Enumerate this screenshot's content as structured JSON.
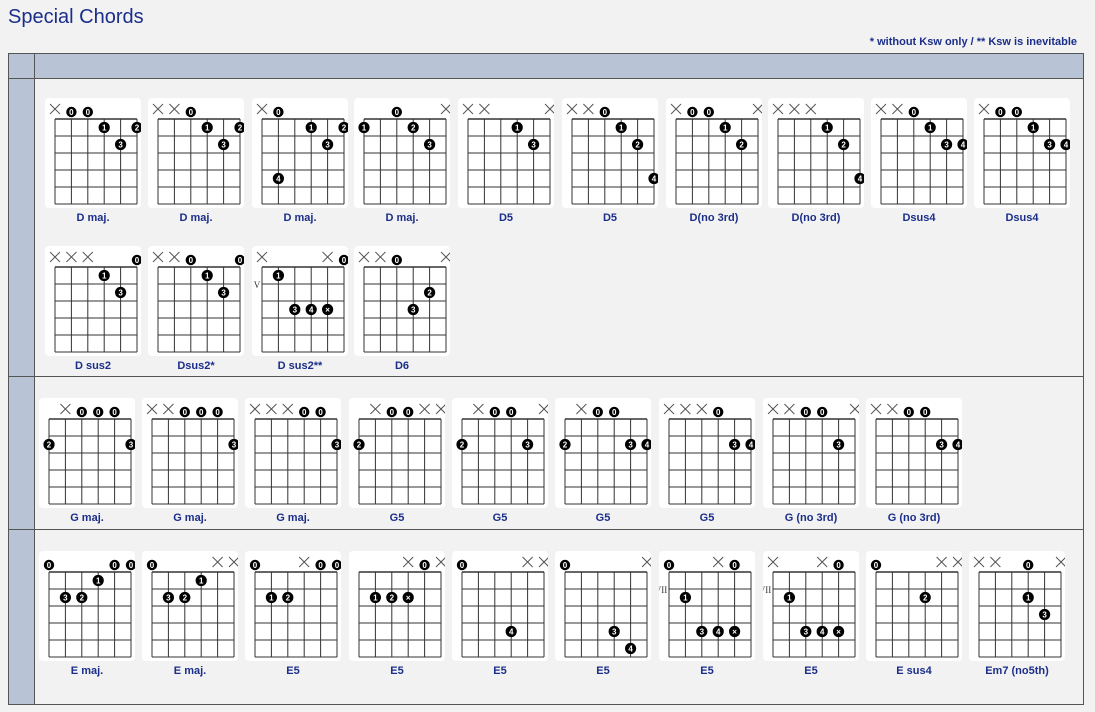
{
  "title": "Special Chords",
  "legend": "* without Ksw only  / ** Ksw is inevitable",
  "marks": {
    "open": "0",
    "mute": "×",
    "fingers": [
      "1",
      "2",
      "3",
      "4"
    ]
  },
  "groups": [
    {
      "chords": [
        {
          "name": "D maj.",
          "top": [
            "x",
            "o",
            "o",
            "",
            "",
            ""
          ],
          "dots": [
            [
              1,
              3,
              "1"
            ],
            [
              1,
              5,
              "2"
            ],
            [
              2,
              4,
              "3"
            ]
          ]
        },
        {
          "name": "D maj.",
          "top": [
            "x",
            "x",
            "o",
            "",
            "",
            ""
          ],
          "dots": [
            [
              1,
              3,
              "1"
            ],
            [
              1,
              5,
              "2"
            ],
            [
              2,
              4,
              "3"
            ]
          ]
        },
        {
          "name": "D maj.",
          "top": [
            "x",
            "o",
            "",
            "",
            "",
            ""
          ],
          "dots": [
            [
              1,
              3,
              "1"
            ],
            [
              1,
              5,
              "2"
            ],
            [
              2,
              4,
              "3"
            ],
            [
              4,
              1,
              "4"
            ]
          ]
        },
        {
          "name": "D maj.",
          "top": [
            "",
            "",
            "o",
            "",
            "",
            "x"
          ],
          "dots": [
            [
              1,
              0,
              "1"
            ],
            [
              1,
              3,
              "2"
            ],
            [
              2,
              4,
              "3"
            ]
          ]
        },
        {
          "name": "D5",
          "top": [
            "x",
            "x",
            "",
            "",
            "",
            "x"
          ],
          "dots": [
            [
              1,
              3,
              "1"
            ],
            [
              2,
              4,
              "3"
            ]
          ]
        },
        {
          "name": "D5",
          "top": [
            "x",
            "x",
            "o",
            "",
            "",
            ""
          ],
          "dots": [
            [
              1,
              3,
              "1"
            ],
            [
              2,
              4,
              "2"
            ],
            [
              4,
              5,
              "4"
            ]
          ]
        },
        {
          "name": "D(no 3rd)",
          "top": [
            "x",
            "o",
            "o",
            "",
            "",
            "x"
          ],
          "dots": [
            [
              1,
              3,
              "1"
            ],
            [
              2,
              4,
              "2"
            ]
          ]
        },
        {
          "name": "D(no 3rd)",
          "top": [
            "x",
            "x",
            "x",
            "",
            "",
            ""
          ],
          "dots": [
            [
              1,
              3,
              "1"
            ],
            [
              2,
              4,
              "2"
            ],
            [
              4,
              5,
              "4"
            ]
          ]
        },
        {
          "name": "Dsus4",
          "top": [
            "x",
            "x",
            "o",
            "",
            "",
            ""
          ],
          "dots": [
            [
              1,
              3,
              "1"
            ],
            [
              2,
              4,
              "3"
            ],
            [
              2,
              5,
              "4"
            ]
          ]
        },
        {
          "name": "Dsus4",
          "top": [
            "x",
            "o",
            "o",
            "",
            "",
            ""
          ],
          "dots": [
            [
              1,
              3,
              "1"
            ],
            [
              2,
              4,
              "3"
            ],
            [
              2,
              5,
              "4"
            ]
          ]
        },
        {
          "name": "D sus2",
          "top": [
            "x",
            "x",
            "x",
            "",
            "",
            "o"
          ],
          "dots": [
            [
              1,
              3,
              "1"
            ],
            [
              2,
              4,
              "3"
            ]
          ]
        },
        {
          "name": "Dsus2*",
          "top": [
            "x",
            "x",
            "o",
            "",
            "",
            "o"
          ],
          "dots": [
            [
              1,
              3,
              "1"
            ],
            [
              2,
              4,
              "3"
            ]
          ]
        },
        {
          "name": "D sus2**",
          "top": [
            "x",
            "",
            "",
            "",
            "x",
            "o"
          ],
          "fret": "V",
          "dots": [
            [
              1,
              1,
              "1"
            ],
            [
              3,
              2,
              "3"
            ],
            [
              3,
              3,
              "4"
            ],
            [
              3,
              4,
              "x"
            ]
          ]
        },
        {
          "name": "D6",
          "top": [
            "x",
            "x",
            "o",
            "",
            "",
            "x"
          ],
          "dots": [
            [
              2,
              4,
              "2"
            ],
            [
              3,
              3,
              "3"
            ]
          ]
        }
      ]
    },
    {
      "chords": [
        {
          "name": "G maj.",
          "top": [
            "",
            "x",
            "o",
            "o",
            "o",
            ""
          ],
          "dots": [
            [
              2,
              0,
              "2"
            ],
            [
              2,
              5,
              "3"
            ]
          ]
        },
        {
          "name": "G maj.",
          "top": [
            "x",
            "x",
            "o",
            "o",
            "o",
            ""
          ],
          "dots": [
            [
              2,
              5,
              "3"
            ]
          ]
        },
        {
          "name": "G maj.",
          "top": [
            "x",
            "x",
            "x",
            "o",
            "o",
            ""
          ],
          "dots": [
            [
              2,
              5,
              "3"
            ]
          ]
        },
        {
          "name": "G5",
          "top": [
            "",
            "x",
            "o",
            "o",
            "x",
            "x"
          ],
          "dots": [
            [
              2,
              0,
              "2"
            ]
          ]
        },
        {
          "name": "G5",
          "top": [
            "",
            "x",
            "o",
            "o",
            "",
            "x"
          ],
          "dots": [
            [
              2,
              0,
              "2"
            ],
            [
              2,
              4,
              "3"
            ]
          ]
        },
        {
          "name": "G5",
          "top": [
            "",
            "x",
            "o",
            "o",
            "",
            ""
          ],
          "dots": [
            [
              2,
              0,
              "2"
            ],
            [
              2,
              4,
              "3"
            ],
            [
              2,
              5,
              "4"
            ]
          ]
        },
        {
          "name": "G5",
          "top": [
            "x",
            "x",
            "x",
            "o",
            "",
            ""
          ],
          "dots": [
            [
              2,
              4,
              "3"
            ],
            [
              2,
              5,
              "4"
            ]
          ]
        },
        {
          "name": "G (no 3rd)",
          "top": [
            "x",
            "x",
            "o",
            "o",
            "",
            "x"
          ],
          "dots": [
            [
              2,
              4,
              "3"
            ]
          ]
        },
        {
          "name": "G (no 3rd)",
          "top": [
            "x",
            "x",
            "o",
            "o",
            "",
            ""
          ],
          "dots": [
            [
              2,
              4,
              "3"
            ],
            [
              2,
              5,
              "4"
            ]
          ]
        }
      ]
    },
    {
      "chords": [
        {
          "name": "E maj.",
          "top": [
            "o",
            "",
            "",
            "",
            "o",
            "o"
          ],
          "dots": [
            [
              1,
              3,
              "1"
            ],
            [
              2,
              1,
              "3"
            ],
            [
              2,
              2,
              "2"
            ]
          ]
        },
        {
          "name": "E maj.",
          "top": [
            "o",
            "",
            "",
            "",
            "x",
            "x"
          ],
          "dots": [
            [
              1,
              3,
              "1"
            ],
            [
              2,
              1,
              "3"
            ],
            [
              2,
              2,
              "2"
            ]
          ]
        },
        {
          "name": "E5",
          "top": [
            "o",
            "",
            "",
            "x",
            "o",
            "o"
          ],
          "dots": [
            [
              2,
              1,
              "1"
            ],
            [
              2,
              2,
              "2"
            ]
          ]
        },
        {
          "name": "E5",
          "top": [
            "",
            "",
            "",
            "x",
            "o",
            "x"
          ],
          "dots": [
            [
              2,
              1,
              "1"
            ],
            [
              2,
              2,
              "2"
            ],
            [
              2,
              3,
              "x"
            ]
          ]
        },
        {
          "name": "E5",
          "top": [
            "o",
            "",
            "",
            "",
            "x",
            "x"
          ],
          "bar": [
            2,
            1,
            2,
            "1 1"
          ],
          "dots": [
            [
              4,
              3,
              "4"
            ]
          ]
        },
        {
          "name": "E5",
          "top": [
            "o",
            "",
            "",
            "",
            "",
            "x"
          ],
          "bar": [
            2,
            1,
            2,
            "1 1"
          ],
          "dots": [
            [
              4,
              3,
              "3"
            ],
            [
              5,
              4,
              "4"
            ]
          ]
        },
        {
          "name": "E5",
          "top": [
            "o",
            "",
            "",
            "x",
            "o",
            ""
          ],
          "fret": "VII",
          "dots": [
            [
              2,
              1,
              "1"
            ],
            [
              4,
              2,
              "3"
            ],
            [
              4,
              3,
              "4"
            ],
            [
              4,
              4,
              "x"
            ]
          ]
        },
        {
          "name": "E5",
          "top": [
            "x",
            "",
            "",
            "x",
            "o",
            ""
          ],
          "fret": "VII",
          "dots": [
            [
              2,
              1,
              "1"
            ],
            [
              4,
              2,
              "3"
            ],
            [
              4,
              3,
              "4"
            ],
            [
              4,
              4,
              "x"
            ]
          ]
        },
        {
          "name": "E sus4",
          "top": [
            "o",
            "",
            "",
            "",
            "x",
            "x"
          ],
          "bar": [
            2,
            1,
            2,
            "1 1"
          ],
          "dots": [
            [
              2,
              3,
              "2"
            ]
          ]
        },
        {
          "name": "Em7 (no5th)",
          "top": [
            "x",
            "x",
            "",
            "o",
            "",
            "x"
          ],
          "dots": [
            [
              2,
              3,
              "1"
            ],
            [
              3,
              4,
              "3"
            ]
          ]
        }
      ]
    }
  ]
}
